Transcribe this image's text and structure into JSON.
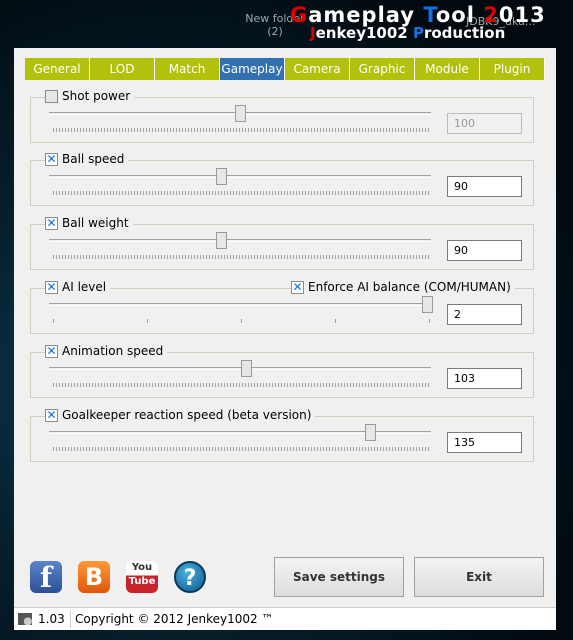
{
  "background": {
    "desktop_icons": [
      "New folder (2)",
      "JDBK9_uka..."
    ]
  },
  "header": {
    "title_parts": [
      "G",
      "ameplay ",
      "T",
      "ool ",
      "2",
      "013"
    ],
    "subtitle_parts": [
      "J",
      "enkey1002 ",
      "P",
      "roduction"
    ]
  },
  "tabs": [
    {
      "label": "General"
    },
    {
      "label": "LOD"
    },
    {
      "label": "Match"
    },
    {
      "label": "Gameplay",
      "active": true
    },
    {
      "label": "Camera"
    },
    {
      "label": "Graphic"
    },
    {
      "label": "Module"
    },
    {
      "label": "Plugin"
    }
  ],
  "settings": [
    {
      "label": "Shot power",
      "checked": false,
      "slider_percent": 50,
      "value": "100",
      "enabled": false
    },
    {
      "label": "Ball speed",
      "checked": true,
      "slider_percent": 45,
      "value": "90",
      "enabled": true
    },
    {
      "label": "Ball weight",
      "checked": true,
      "slider_percent": 45,
      "value": "90",
      "enabled": true
    },
    {
      "label": "AI level",
      "checked": true,
      "slider_percent": 100,
      "value": "2",
      "enabled": true,
      "extra_checkbox": {
        "label": "Enforce AI balance (COM/HUMAN)",
        "checked": true
      }
    },
    {
      "label": "Animation speed",
      "checked": true,
      "slider_percent": 51.5,
      "value": "103",
      "enabled": true
    },
    {
      "label": "Goalkeeper reaction speed (beta version)",
      "checked": true,
      "slider_percent": 84,
      "value": "135",
      "enabled": true
    }
  ],
  "social_icons": [
    "facebook-icon",
    "blogger-icon",
    "youtube-icon",
    "help-icon"
  ],
  "youtube_text": [
    "You",
    "Tube"
  ],
  "buttons": {
    "save": "Save settings",
    "exit": "Exit"
  },
  "status": {
    "version": "1.03",
    "copyright": "Copyright © 2012 Jenkey1002 ™"
  }
}
